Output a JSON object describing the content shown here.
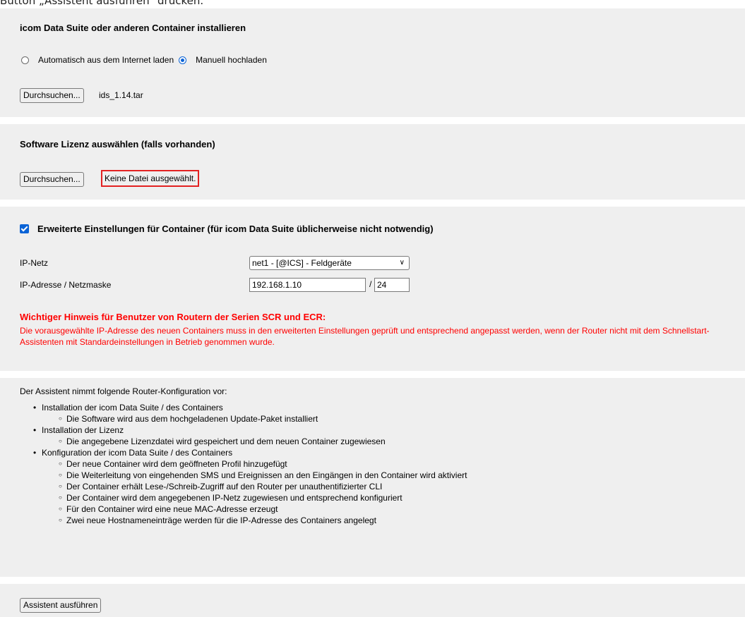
{
  "caption": "Button „Assistent ausführen“ drücken.",
  "install_section": {
    "title": "icom Data Suite oder anderen Container installieren",
    "radio_auto_label": "Automatisch aus dem Internet laden",
    "radio_manual_label": "Manuell hochladen",
    "selected": "manual",
    "browse_label": "Durchsuchen...",
    "file_name": "ids_1.14.tar"
  },
  "license_section": {
    "title": "Software Lizenz auswählen (falls vorhanden)",
    "browse_label": "Durchsuchen...",
    "file_name": "Keine Datei ausgewählt.",
    "highlight_color": "#e32222"
  },
  "advanced_section": {
    "checkbox_label": "Erweiterte Einstellungen für Container (für icom Data Suite üblicherweise nicht notwendig)",
    "checked": true,
    "ip_net_label": "IP-Netz",
    "ip_net_value": "net1 - [@ICS] - Feldgeräte",
    "ip_addr_label": "IP-Adresse / Netzmaske",
    "ip_addr_value": "192.168.1.10",
    "netmask_separator": "/",
    "netmask_value": "24",
    "warning_title": "Wichtiger Hinweis für Benutzer von Routern der Serien SCR und ECR:",
    "warning_text": "Die vorausgewählte IP-Adresse des neuen Containers muss in den erweiterten Einstellungen geprüft und entsprechend angepasst werden, wenn der Router nicht mit dem Schnellstart-Assistenten mit Standardeinstellungen in Betrieb genommen wurde.",
    "warning_color": "#ff0000"
  },
  "summary_section": {
    "intro": "Der Assistent nimmt folgende Router-Konfiguration vor:",
    "items": [
      {
        "label": "Installation der icom Data Suite / des Containers",
        "sub": [
          "Die Software wird aus dem hochgeladenen Update-Paket installiert"
        ]
      },
      {
        "label": "Installation der Lizenz",
        "sub": [
          "Die angegebene Lizenzdatei wird gespeichert und dem neuen Container zugewiesen"
        ]
      },
      {
        "label": "Konfiguration der icom Data Suite / des Containers",
        "sub": [
          "Der neue Container wird dem geöffneten Profil hinzugefügt",
          "Die Weiterleitung von eingehenden SMS und Ereignissen an den Eingängen in den Container wird aktiviert",
          "Der Container erhält Lese-/Schreib-Zugriff auf den Router per unauthentifizierter CLI",
          "Der Container wird dem angegebenen IP-Netz zugewiesen und entsprechend konfiguriert",
          "Für den Container wird eine neue MAC-Adresse erzeugt",
          "Zwei neue Hostnameneinträge werden für die IP-Adresse des Containers angelegt"
        ]
      }
    ]
  },
  "run_button_label": "Assistent ausführen",
  "accent_color": "#0a63d6",
  "panel_color": "#efefef"
}
